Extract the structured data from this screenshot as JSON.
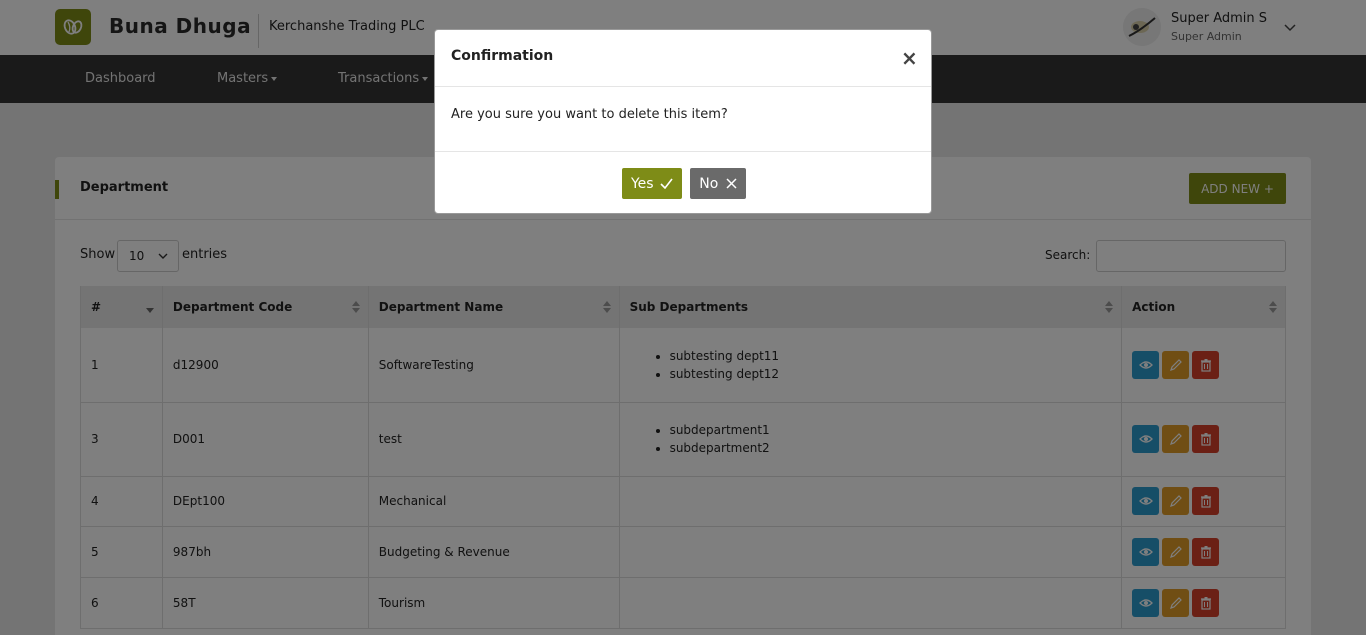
{
  "header": {
    "brand": "Buna Dhuga",
    "company": "Kerchanshe Trading PLC",
    "user_name": "Super Admin S",
    "user_role": "Super Admin"
  },
  "nav": {
    "items": [
      {
        "label": "Dashboard"
      },
      {
        "label": "Masters"
      },
      {
        "label": "Transactions"
      }
    ]
  },
  "card": {
    "title": "Department",
    "add_new_label": "ADD NEW +",
    "show_label": "Show",
    "entries_value": "10",
    "entries_label": "entries",
    "search_label": "Search:"
  },
  "table": {
    "columns": [
      "#",
      "Department Code",
      "Department Name",
      "Sub Departments",
      "Action"
    ],
    "rows": [
      {
        "num": "1",
        "code": "d12900",
        "name": "SoftwareTesting",
        "subs": [
          "subtesting dept11",
          "subtesting dept12"
        ]
      },
      {
        "num": "3",
        "code": "D001",
        "name": "test",
        "subs": [
          "subdepartment1",
          "subdepartment2"
        ]
      },
      {
        "num": "4",
        "code": "DEpt100",
        "name": "Mechanical",
        "subs": []
      },
      {
        "num": "5",
        "code": "987bh",
        "name": "Budgeting & Revenue",
        "subs": []
      },
      {
        "num": "6",
        "code": "58T",
        "name": "Tourism",
        "subs": []
      }
    ]
  },
  "modal": {
    "title": "Confirmation",
    "close": "×",
    "message": "Are you sure you want to delete this item?",
    "yes_label": "Yes",
    "no_label": "No"
  },
  "colors": {
    "accent": "#7e8c17",
    "nav_bg": "#353535",
    "view": "#2d9ccf",
    "edit": "#e09d29",
    "delete": "#d7402b"
  }
}
